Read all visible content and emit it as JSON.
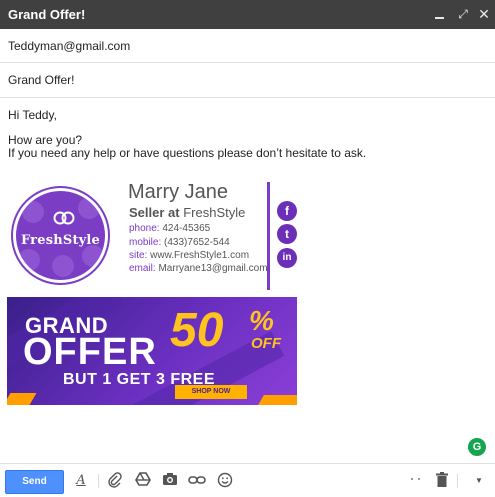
{
  "window": {
    "title": "Grand Offer!",
    "controls": {
      "minimize": "minimize-icon",
      "expand": "expand-icon",
      "close": "close-icon"
    }
  },
  "to": {
    "value": "Teddyman@gmail.com"
  },
  "subject": {
    "value": "Grand Offer!"
  },
  "body": {
    "greeting": "Hi Teddy,",
    "line1": "How are you?",
    "line2": "If you need any help or have questions please don’t hesitate to ask."
  },
  "signature": {
    "logo_text": "FreshStyle",
    "name": "Marry Jane",
    "role": "Seller at",
    "company": "FreshStyle",
    "phone_label": "phone:",
    "phone": "424-45365",
    "mobile_label": "mobile:",
    "mobile": "(433)7652-544",
    "site_label": "site:",
    "site": "www.FreshStyle1.com",
    "email_label": "email:",
    "email": "Marryane13@gmail.com",
    "social": [
      {
        "icon": "facebook-icon",
        "glyph": "f"
      },
      {
        "icon": "twitter-icon",
        "glyph": "t"
      },
      {
        "icon": "linkedin-icon",
        "glyph": "in"
      }
    ],
    "accent_color": "#7a3dc4"
  },
  "banner": {
    "grand": "GRAND",
    "offer": "OFFER",
    "percent": "50",
    "percent_sign": "%",
    "off": "OFF",
    "subline": "BUT 1 GET 3 FREE",
    "cta": "SHOP NOW"
  },
  "toolbar": {
    "send_label": "Send",
    "icons": [
      "format-text-icon",
      "attach-icon",
      "drive-icon",
      "photo-icon",
      "link-icon",
      "emoji-icon",
      "more-options-icon",
      "trash-icon",
      "dropdown-icon"
    ]
  },
  "grammarly": {
    "glyph": "G"
  }
}
